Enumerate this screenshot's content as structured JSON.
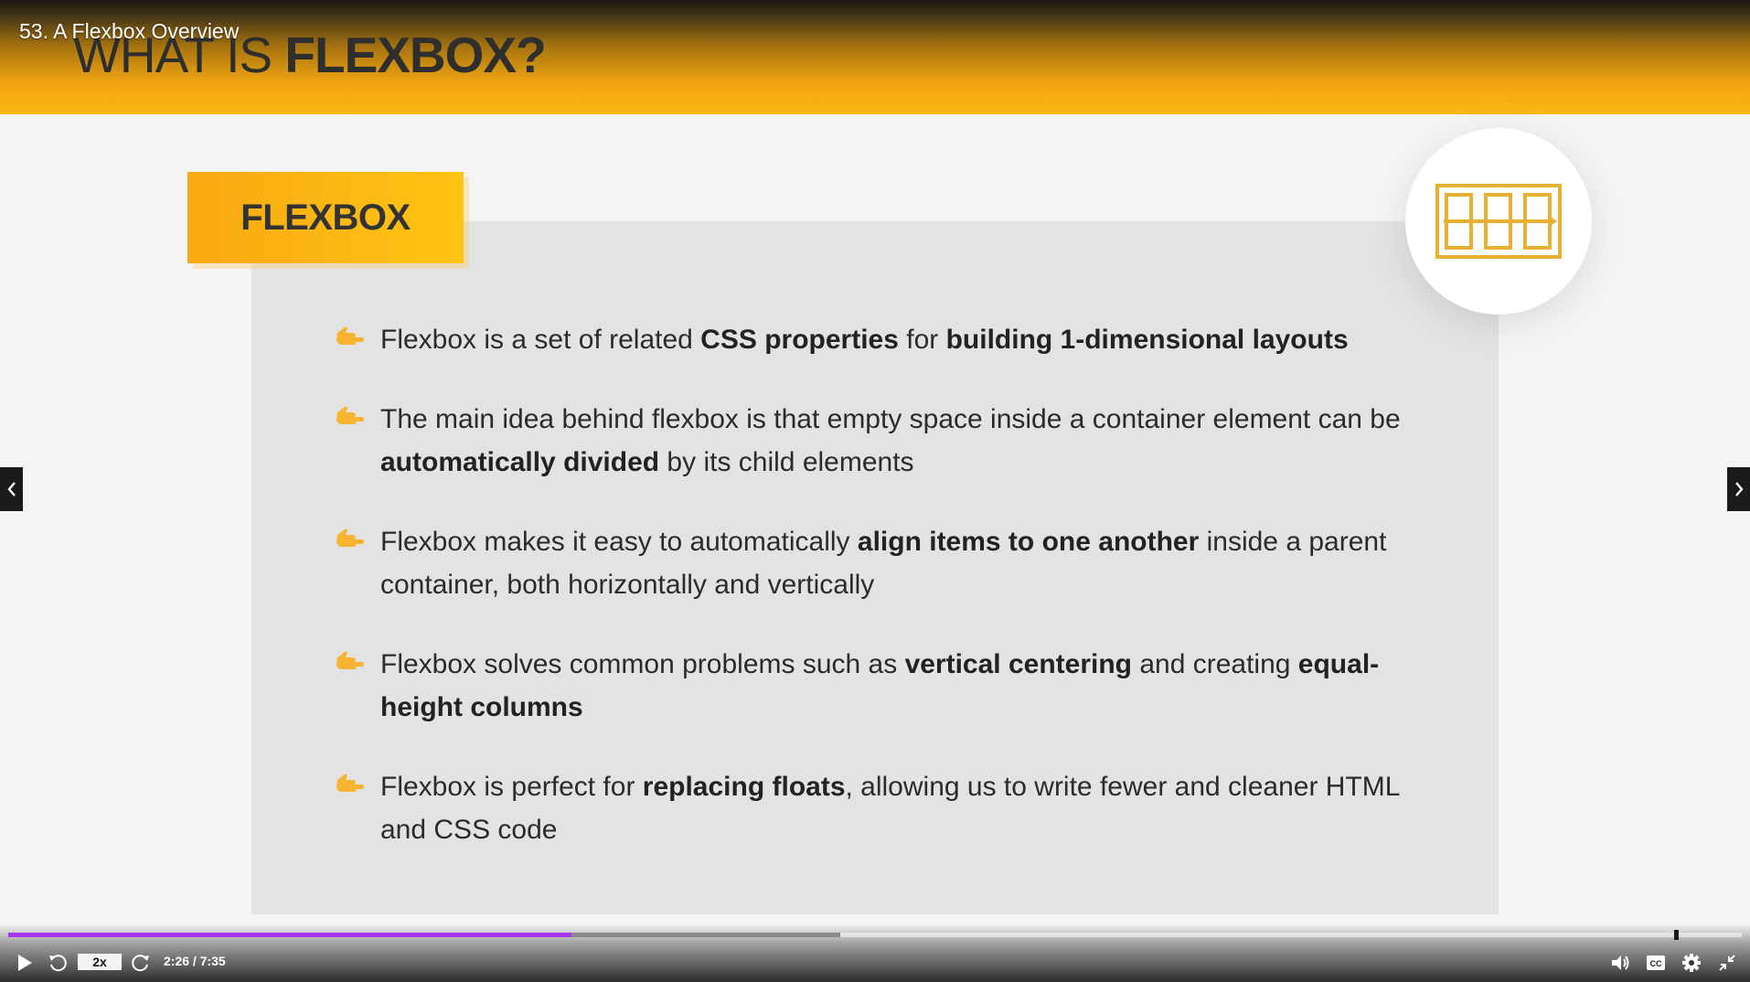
{
  "lecture": {
    "title": "53. A Flexbox Overview"
  },
  "slide": {
    "title_light": "WHAT IS ",
    "title_bold": "FLEXBOX?",
    "badge": "FLEXBOX",
    "bullets": [
      {
        "segments": [
          {
            "text": "Flexbox is a set of related ",
            "bold": false
          },
          {
            "text": "CSS properties",
            "bold": true
          },
          {
            "text": " for ",
            "bold": false
          },
          {
            "text": "building 1-dimensional layouts",
            "bold": true
          }
        ]
      },
      {
        "segments": [
          {
            "text": "The main idea behind flexbox is that empty space inside a container element can be ",
            "bold": false
          },
          {
            "text": "automatically divided",
            "bold": true
          },
          {
            "text": " by its child elements",
            "bold": false
          }
        ]
      },
      {
        "segments": [
          {
            "text": "Flexbox makes it easy to automatically ",
            "bold": false
          },
          {
            "text": "align items to one another",
            "bold": true
          },
          {
            "text": " inside a parent container, both horizontally and vertically",
            "bold": false
          }
        ]
      },
      {
        "segments": [
          {
            "text": "Flexbox solves common problems such as ",
            "bold": false
          },
          {
            "text": "vertical centering",
            "bold": true
          },
          {
            "text": " and creating ",
            "bold": false
          },
          {
            "text": "equal-height columns",
            "bold": true
          }
        ]
      },
      {
        "segments": [
          {
            "text": "Flexbox is perfect for ",
            "bold": false
          },
          {
            "text": "replacing floats",
            "bold": true
          },
          {
            "text": ", allowing us to write fewer and cleaner HTML and CSS code",
            "bold": false
          }
        ]
      }
    ]
  },
  "player": {
    "speed": "2x",
    "time": "2:26 / 7:35",
    "played_fraction": 0.325,
    "buffered_fraction": 0.48
  },
  "colors": {
    "accent": "#a435f0",
    "header_orange": "#fbb714",
    "slide_text": "#2b2b2b"
  },
  "icons": {
    "play": "play-icon",
    "rewind": "rewind-5-icon",
    "forward": "forward-5-icon",
    "volume": "volume-icon",
    "captions": "captions-icon",
    "settings": "gear-icon",
    "fullscreen": "exit-fullscreen-icon",
    "prev": "chevron-left-icon",
    "next": "chevron-right-icon",
    "bullet": "pointing-hand-icon",
    "flex_diagram": "flexbox-layout-icon"
  }
}
